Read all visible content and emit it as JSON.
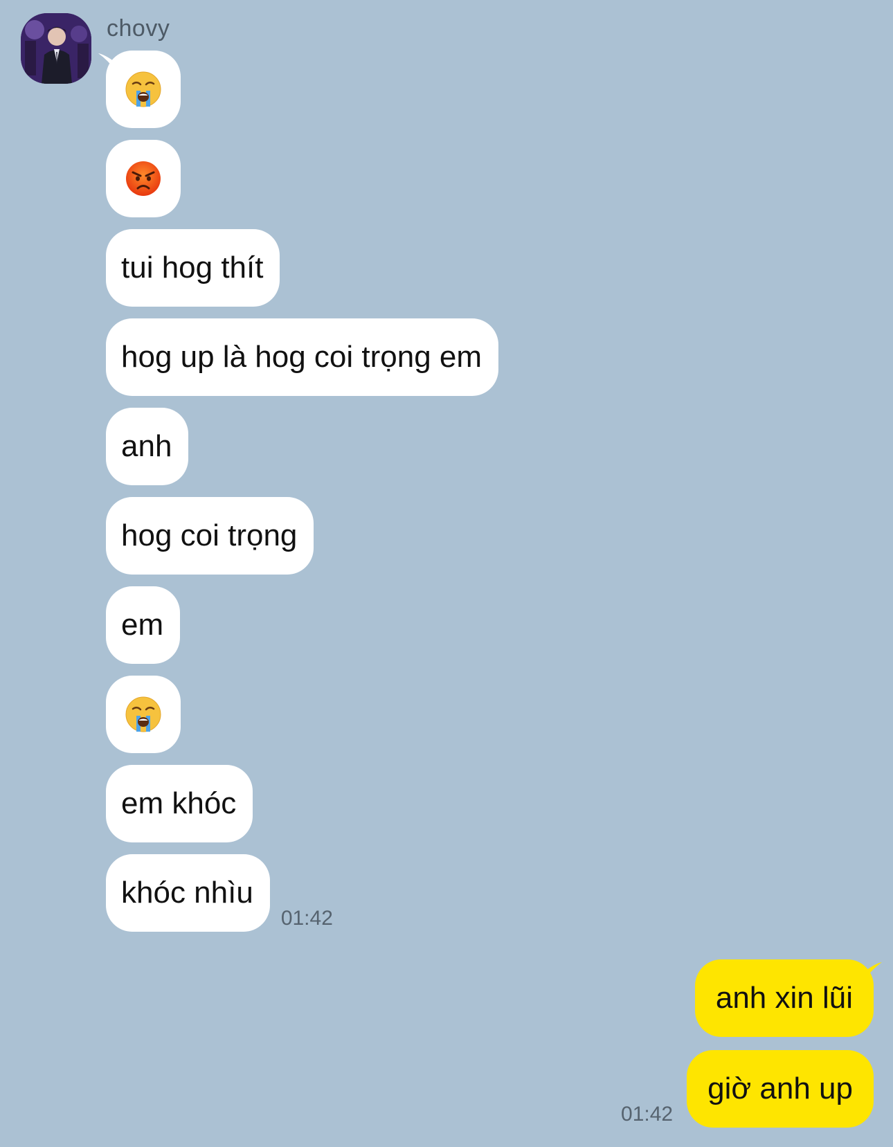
{
  "contact": {
    "name": "chovy",
    "avatar_icon": "profile-photo-avatar"
  },
  "colors": {
    "background": "#abc1d3",
    "incoming_bubble": "#ffffff",
    "outgoing_bubble": "#fee500",
    "timestamp": "#56636f"
  },
  "incoming_messages": [
    {
      "type": "emoji",
      "emoji": "loudly-crying-face",
      "text": "😭"
    },
    {
      "type": "emoji",
      "emoji": "pouting-face",
      "text": "😡"
    },
    {
      "type": "text",
      "text": "tui hog thít"
    },
    {
      "type": "text",
      "text": "hog up là hog coi trọng em"
    },
    {
      "type": "text",
      "text": "anh"
    },
    {
      "type": "text",
      "text": "hog coi trọng"
    },
    {
      "type": "text",
      "text": "em"
    },
    {
      "type": "emoji",
      "emoji": "loudly-crying-face",
      "text": "😭"
    },
    {
      "type": "text",
      "text": "em khóc"
    },
    {
      "type": "text",
      "text": "khóc nhìu"
    }
  ],
  "incoming_time": "01:42",
  "outgoing_messages": [
    {
      "type": "text",
      "text": "anh xin lũi"
    },
    {
      "type": "text",
      "text": "giờ anh up"
    }
  ],
  "outgoing_time": "01:42"
}
